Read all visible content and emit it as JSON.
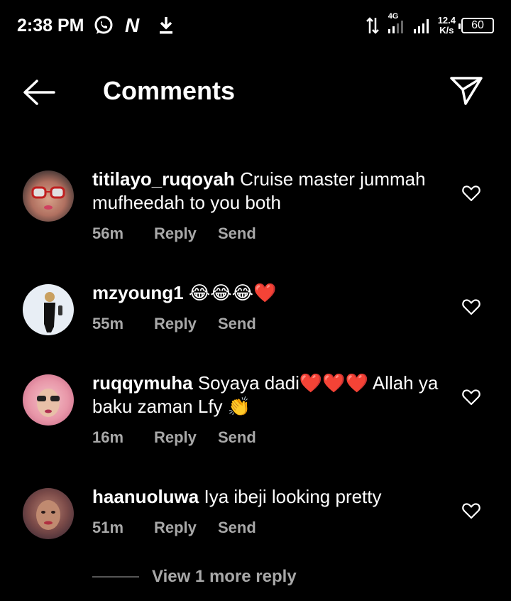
{
  "status_bar": {
    "time": "2:38 PM",
    "network": "4G",
    "speed_value": "12.4",
    "speed_unit": "K/s",
    "battery": "60",
    "icons": [
      "whatsapp-icon",
      "notification-n-icon",
      "download-icon",
      "data-arrows-icon",
      "signal-icon",
      "battery-icon"
    ]
  },
  "header": {
    "title": "Comments",
    "back_icon": "back-arrow-icon",
    "share_icon": "send-icon"
  },
  "comments": [
    {
      "username": "titilayo_ruqoyah",
      "text": "Cruise master jummah mufheedah to you both",
      "time": "56m",
      "reply": "Reply",
      "send": "Send"
    },
    {
      "username": "mzyoung1",
      "text": "😂😂😂❤️",
      "time": "55m",
      "reply": "Reply",
      "send": "Send"
    },
    {
      "username": "ruqqymuha",
      "text": "Soyaya dadi❤️❤️❤️ Allah ya baku zaman Lfy 👏",
      "time": "16m",
      "reply": "Reply",
      "send": "Send"
    },
    {
      "username": "haanuoluwa",
      "text": "Iya ibeji looking pretty",
      "time": "51m",
      "reply": "Reply",
      "send": "Send"
    }
  ],
  "view_more": "View 1 more reply",
  "colors": {
    "background": "#000000",
    "text": "#ffffff",
    "secondary_text": "#a8a8a8"
  }
}
